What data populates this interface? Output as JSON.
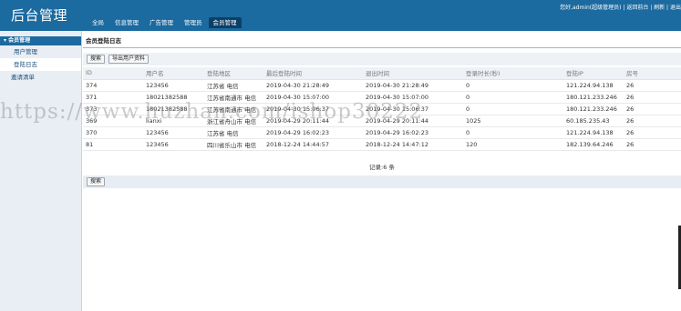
{
  "header": {
    "brand": "后台管理",
    "nav": [
      "全局",
      "信息管理",
      "广告管理",
      "管理员",
      "会员管理"
    ],
    "active_nav_index": 4,
    "user_links": "您好,admin(超级管理员) | 返回前台 | 刷新 | 退出"
  },
  "sidebar": {
    "section_title": "会员管理",
    "items": [
      "用户管理",
      "登陆日志"
    ],
    "active_item_index": 1,
    "extra_item": "邀请清单"
  },
  "main": {
    "title": "会员登陆日志",
    "search_label": "搜索",
    "export_label": "导出用户资料",
    "columns": [
      "ID",
      "用户名",
      "登陆地区",
      "最后登陆时间",
      "退出时间",
      "登录时长(秒)",
      "登陆IP",
      "房号"
    ],
    "rows": [
      [
        "374",
        "123456",
        "江苏省 电信",
        "2019-04-30 21:28:49",
        "2019-04-30 21:28:49",
        "0",
        "121.224.94.138",
        "26"
      ],
      [
        "371",
        "18021382588",
        "江苏省南通市 电信",
        "2019-04-30 15:07:00",
        "2019-04-30 15:07:00",
        "0",
        "180.121.233.246",
        "26"
      ],
      [
        "373",
        "18021382588",
        "江苏省南通市 电信",
        "2019-04-30 15:06:37",
        "2019-04-30 15:06:37",
        "0",
        "180.121.233.246",
        "26"
      ],
      [
        "369",
        "lianxi",
        "浙江省舟山市 电信",
        "2019-04-29 20:11:44",
        "2019-04-29 20:11:44",
        "1025",
        "60.185.235.43",
        "26"
      ],
      [
        "370",
        "123456",
        "江苏省 电信",
        "2019-04-29 16:02:23",
        "2019-04-29 16:02:23",
        "0",
        "121.224.94.138",
        "26"
      ],
      [
        "81",
        "123456",
        "四川省乐山市 电信",
        "2018-12-24 14:44:57",
        "2018-12-24 14:47:12",
        "120",
        "182.139.64.246",
        "26"
      ]
    ],
    "summary": "记录:6 条",
    "bottom_search_label": "搜索"
  },
  "watermark": "https://www.huzhan.com/ishop30222"
}
